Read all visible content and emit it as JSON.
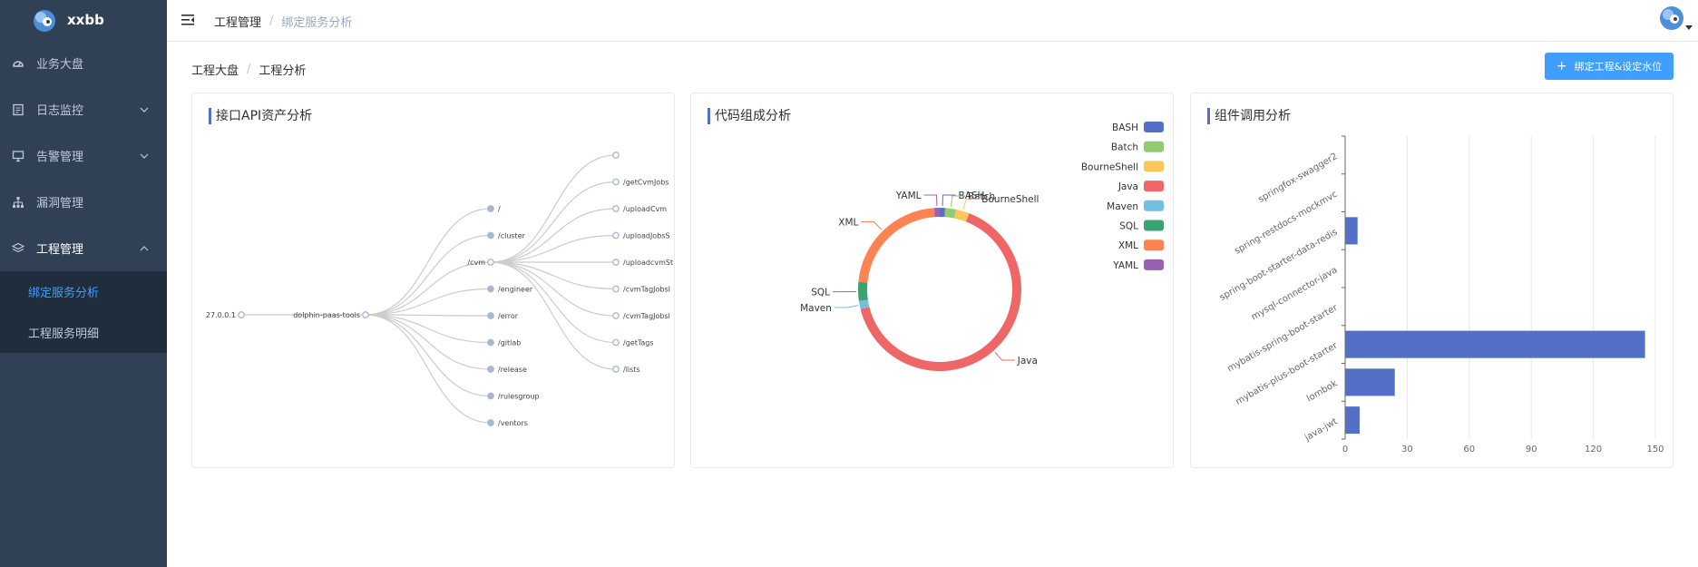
{
  "app": {
    "brand": "xxbb"
  },
  "sidebar": {
    "items": [
      {
        "label": "业务大盘",
        "icon": "dashboard-icon",
        "has_arrow": false
      },
      {
        "label": "日志监控",
        "icon": "document-icon",
        "has_arrow": true
      },
      {
        "label": "告警管理",
        "icon": "monitor-icon",
        "has_arrow": true
      },
      {
        "label": "漏洞管理",
        "icon": "sitemap-icon",
        "has_arrow": false
      },
      {
        "label": "工程管理",
        "icon": "layers-icon",
        "has_arrow": true,
        "expanded": true
      }
    ],
    "submenu": [
      {
        "label": "绑定服务分析",
        "active": true
      },
      {
        "label": "工程服务明细",
        "active": false
      }
    ]
  },
  "header": {
    "breadcrumb": [
      "工程管理",
      "绑定服务分析"
    ]
  },
  "page": {
    "breadcrumb": [
      "工程大盘",
      "工程分析"
    ],
    "bind_button_label": "绑定工程&设定水位"
  },
  "cards": {
    "api_title": "接口API资产分析",
    "code_title": "代码组成分析",
    "comp_title": "组件调用分析"
  },
  "colors": {
    "sidebar_bg": "#304156",
    "submenu_bg": "#1f2d3d",
    "active": "#409eff",
    "bar": "#5470c6"
  },
  "chart_data": [
    {
      "type": "tree",
      "root": "27.0.0.1",
      "children": [
        {
          "name": "dolphin-paas-tools",
          "children": [
            {
              "name": "/"
            },
            {
              "name": "/cluster"
            },
            {
              "name": "/cvm",
              "children": [
                {
                  "name": ""
                },
                {
                  "name": "/getCvmJobs"
                },
                {
                  "name": "/uploadCvm"
                },
                {
                  "name": "/uploadJobsS"
                },
                {
                  "name": "/uploadcvmSt"
                },
                {
                  "name": "/cvmTagJobsI"
                },
                {
                  "name": "/cvmTagJobsl"
                },
                {
                  "name": "/getTags"
                },
                {
                  "name": "/lists"
                }
              ]
            },
            {
              "name": "/engineer"
            },
            {
              "name": "/error"
            },
            {
              "name": "/gitlab"
            },
            {
              "name": "/release"
            },
            {
              "name": "/rulesgroup"
            },
            {
              "name": "/ventors"
            }
          ]
        }
      ]
    },
    {
      "type": "pie",
      "variant": "donut",
      "legend_position": "top-right",
      "slices": [
        {
          "name": "BASH",
          "value": 1,
          "color": "#5470c6"
        },
        {
          "name": "Batch",
          "value": 2,
          "color": "#91cc75"
        },
        {
          "name": "BourneShell",
          "value": 2.5,
          "color": "#fac858"
        },
        {
          "name": "Java",
          "value": 61,
          "color": "#ee6666"
        },
        {
          "name": "Maven",
          "value": 1.5,
          "color": "#73c0de"
        },
        {
          "name": "SQL",
          "value": 3.5,
          "color": "#3ba272"
        },
        {
          "name": "XML",
          "value": 21,
          "color": "#fc8452"
        },
        {
          "name": "YAML",
          "value": 1,
          "color": "#9a60b4"
        }
      ]
    },
    {
      "type": "bar",
      "orientation": "horizontal",
      "categories": [
        "springfox-swagger2",
        "spring-restdocs-mockmvc",
        "spring-boot-starter-data-redis",
        "mysql-connector-java",
        "mybatis-spring-boot-starter",
        "mybatis-plus-boot-starter",
        "lombok",
        "java-jwt"
      ],
      "values": [
        0,
        0,
        6,
        0,
        0,
        145,
        24,
        7
      ],
      "xlim": [
        0,
        150
      ],
      "xticks": [
        0,
        30,
        60,
        90,
        120,
        150
      ],
      "grid": true
    }
  ]
}
